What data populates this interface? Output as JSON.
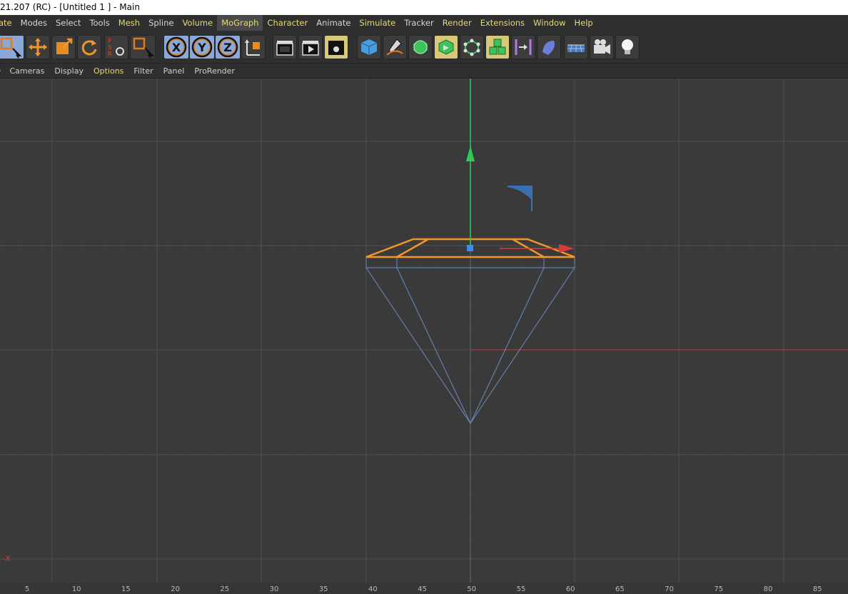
{
  "window": {
    "title": "21.207 (RC) - [Untitled 1 ] - Main"
  },
  "menubar": {
    "items": [
      {
        "label": "ate",
        "hl": true
      },
      {
        "label": "Modes"
      },
      {
        "label": "Select"
      },
      {
        "label": "Tools"
      },
      {
        "label": "Mesh",
        "hl": true
      },
      {
        "label": "Spline"
      },
      {
        "label": "Volume",
        "hl": true
      },
      {
        "label": "MoGraph",
        "active": true
      },
      {
        "label": "Character",
        "hl": true
      },
      {
        "label": "Animate"
      },
      {
        "label": "Simulate",
        "hl": true
      },
      {
        "label": "Tracker"
      },
      {
        "label": "Render",
        "hl": true
      },
      {
        "label": "Extensions",
        "hl": true
      },
      {
        "label": "Window",
        "hl": true
      },
      {
        "label": "Help",
        "hl": true
      }
    ]
  },
  "viewmenu": {
    "items": [
      {
        "label": "Cameras"
      },
      {
        "label": "Display"
      },
      {
        "label": "Options",
        "hl": true
      },
      {
        "label": "Filter"
      },
      {
        "label": "Panel"
      },
      {
        "label": "ProRender"
      }
    ]
  },
  "axis_label": "X",
  "ruler": {
    "ticks": [
      "5",
      "10",
      "15",
      "20",
      "25",
      "30",
      "35",
      "40",
      "45",
      "50",
      "55",
      "60",
      "65",
      "70",
      "75",
      "80",
      "85"
    ]
  },
  "colors": {
    "selection_orange": "#f0962a",
    "wire_blue": "#6a8cc0",
    "axis_green": "#2ecc55",
    "axis_red": "#d83a3a",
    "grid": "#4a4a4a"
  }
}
